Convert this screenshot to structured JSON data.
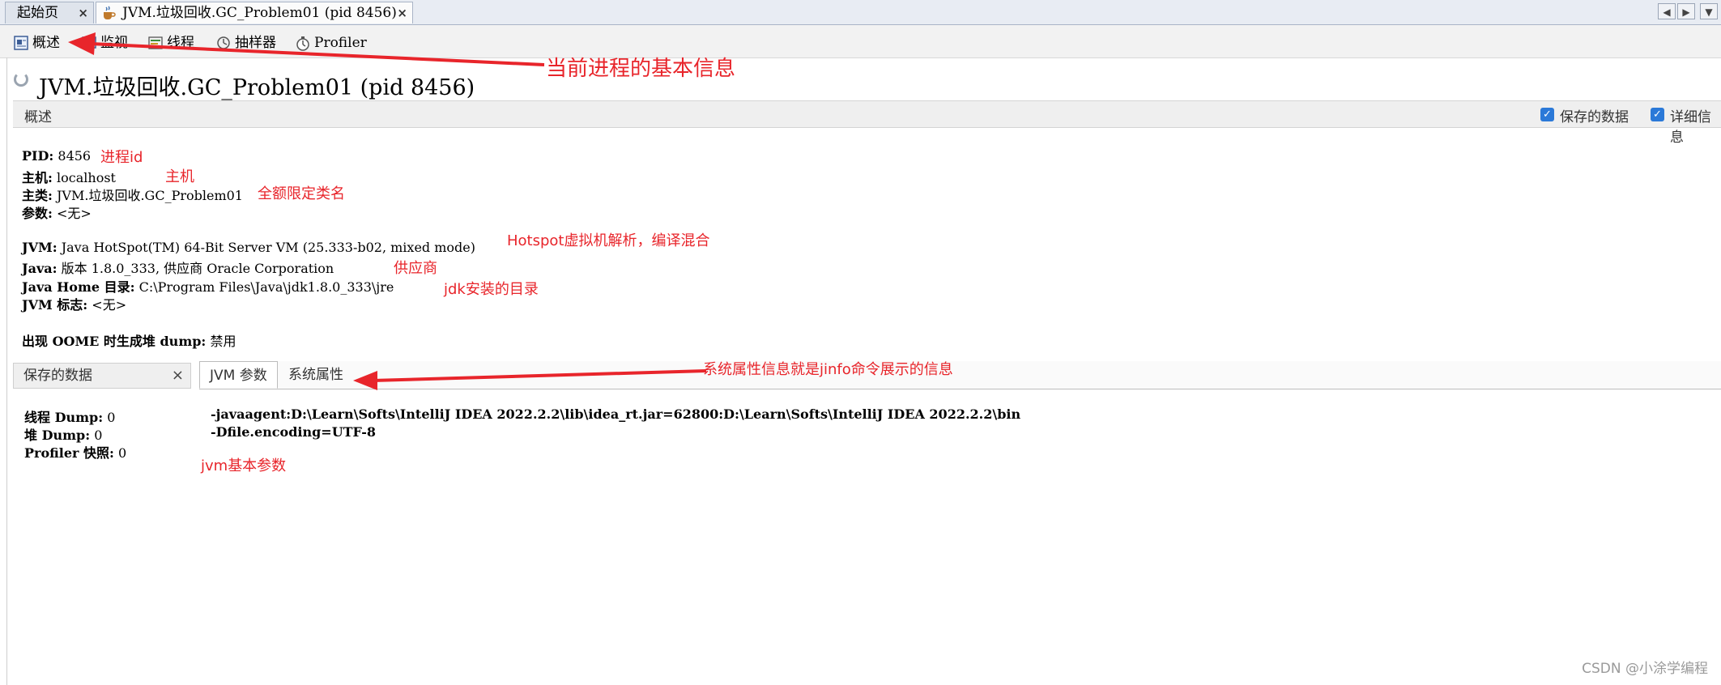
{
  "tabs": [
    {
      "label": "起始页",
      "close": "×"
    },
    {
      "label": "JVM.垃圾回收.GC_Problem01 (pid 8456)",
      "close": "×"
    }
  ],
  "nav": {
    "prev": "◀",
    "next": "▶",
    "menu": "▼"
  },
  "subtabs": [
    "概述",
    "监视",
    "线程",
    "抽样器",
    "Profiler"
  ],
  "title": "JVM.垃圾回收.GC_Problem01 (pid 8456)",
  "section": {
    "label": "概述",
    "checkbox_saved": "保存的数据",
    "checkbox_detail": "详细信息"
  },
  "info": {
    "pid_key": "PID:",
    "pid_val": "8456",
    "host_key": "主机:",
    "host_val": "localhost",
    "mainclass_key": "主类:",
    "mainclass_val": "JVM.垃圾回收.GC_Problem01",
    "args_key": "参数:",
    "args_val": "<无>",
    "jvm_key": "JVM:",
    "jvm_val": "Java HotSpot(TM) 64-Bit Server VM (25.333-b02, mixed mode)",
    "java_key": "Java:",
    "java_val": "版本 1.8.0_333, 供应商 Oracle Corporation",
    "javahome_key": "Java Home 目录:",
    "javahome_val": "C:\\Program Files\\Java\\jdk1.8.0_333\\jre",
    "jvmflags_key": "JVM 标志:",
    "jvmflags_val": "<无>",
    "oome_key": "出现 OOME 时生成堆 dump:",
    "oome_val": "禁用"
  },
  "saved_panel": {
    "tab": "保存的数据",
    "close": "×",
    "thread_dump_key": "线程 Dump:",
    "thread_dump_val": "0",
    "heap_dump_key": "堆 Dump:",
    "heap_dump_val": "0",
    "profiler_key": "Profiler 快照:",
    "profiler_val": "0"
  },
  "right_panel": {
    "tab_jvm": "JVM 参数",
    "tab_sys": "系统属性",
    "line1": "-javaagent:D:\\Learn\\Softs\\IntelliJ  IDEA  2022.2.2\\lib\\idea_rt.jar=62800:D:\\Learn\\Softs\\IntelliJ  IDEA  2022.2.2\\bin",
    "line2": "-Dfile.encoding=UTF-8"
  },
  "annotations": {
    "basic_info": "当前进程的基本信息",
    "pid": "进程id",
    "host": "主机",
    "mainclass": "全额限定类名",
    "hotspot": "Hotspot虚拟机解析，编译混合",
    "vendor": "供应商",
    "jdk_dir": "jdk安装的目录",
    "sysprops": "系统属性信息就是jinfo命令展示的信息",
    "jvm_params": "jvm基本参数"
  },
  "watermark": "CSDN @小涂学编程",
  "colors": {
    "annotation": "#e8252b",
    "checkbox": "#2b79d8"
  }
}
